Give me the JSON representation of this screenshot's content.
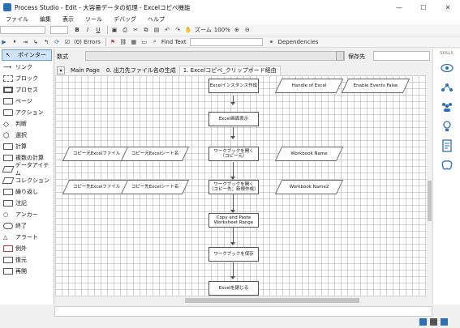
{
  "window": {
    "title": "Process Studio  - Edit - 大容量データの処理 - Excelコピペ機能"
  },
  "menu": [
    "ファイル",
    "編集",
    "表示",
    "ツール",
    "デバッグ",
    "ヘルプ"
  ],
  "toolbar1": {
    "zoom_label": "ズーム",
    "zoom_value": "100%"
  },
  "toolbar2": {
    "errors": "(0) Errors",
    "find": "Find Text",
    "dependencies": "Dependencies"
  },
  "expression": {
    "label": "数式",
    "save_label": "保存先"
  },
  "skills": {
    "title": "SKILLS"
  },
  "palette": [
    "ポインター",
    "リンク",
    "ブロック",
    "プロセス",
    "ページ",
    "アクション",
    "判断",
    "選択",
    "計算",
    "複数の計算",
    "データアイテム",
    "コレクション",
    "繰り返し",
    "注記",
    "アンカー",
    "終了",
    "アラート",
    "例外",
    "復元",
    "再開"
  ],
  "tabs": [
    "Main Page",
    "0. 出力先ファイル名の生成",
    "1. Excelコピペ_クリップボード経由"
  ],
  "flow": {
    "steps": [
      "Excelインスタンス作成",
      "Excel画面表示",
      "ワークブックを開く（コピー元）",
      "ワークブックを開く（コピー先；新規作成）",
      "Copy and Paste Worksheet Range",
      "ワークブックを保存",
      "Excelを閉じる"
    ],
    "data_items": [
      "Handle of Excel",
      "Enable Events False",
      "Workbook Name",
      "Workbook Name2",
      "コピー元Excelファイル",
      "コピー元Excelシート名",
      "コピー先Excelファイル",
      "コピー先Excelシート名"
    ]
  }
}
